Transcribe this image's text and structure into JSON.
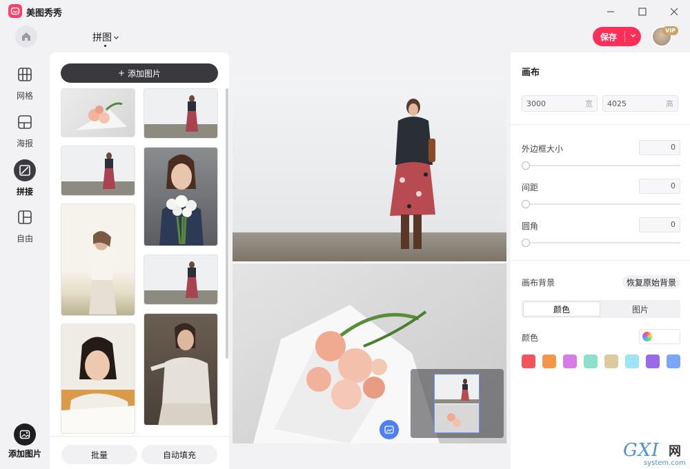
{
  "app": {
    "name": "美图秀秀"
  },
  "header": {
    "mode_title": "拼图",
    "save_label": "保存",
    "vip": "VIP"
  },
  "nav": {
    "items": [
      {
        "label": "网格",
        "icon": "grid-icon"
      },
      {
        "label": "海报",
        "icon": "poster-icon"
      },
      {
        "label": "拼接",
        "icon": "stitch-icon",
        "active": true
      },
      {
        "label": "自由",
        "icon": "free-layout-icon"
      }
    ],
    "add_image_label": "添加图片"
  },
  "library": {
    "add_button": "添加图片",
    "thumbnails": [
      "flower-bouquet",
      "woman-leather-jacket",
      "woman-leather-jacket",
      "woman-white-flowers",
      "woman-white-dress-beach",
      "woman-leather-jacket",
      "woman-reading-book",
      "woman-brown-backdrop"
    ],
    "batch_label": "批量",
    "autofill_label": "自动填充"
  },
  "canvas_panel": {
    "title": "画布",
    "width": "3000",
    "width_unit": "宽",
    "height": "4025",
    "height_unit": "高",
    "border_label": "外边框大小",
    "border_value": "0",
    "spacing_label": "间距",
    "spacing_value": "0",
    "corner_label": "圆角",
    "corner_value": "0",
    "bg_label": "画布背景",
    "restore_label": "恢复原始背景",
    "tabs": [
      "颜色",
      "图片"
    ],
    "active_tab": 0,
    "color_label": "颜色",
    "swatches": [
      "#f0545c",
      "#f5974a",
      "#d77be8",
      "#8ee0cc",
      "#dccba0",
      "#9ee4f5",
      "#9a6be8",
      "#7aa6f5"
    ]
  },
  "watermark": {
    "brand": "GXI",
    "cn": "网",
    "url": "system.com"
  }
}
